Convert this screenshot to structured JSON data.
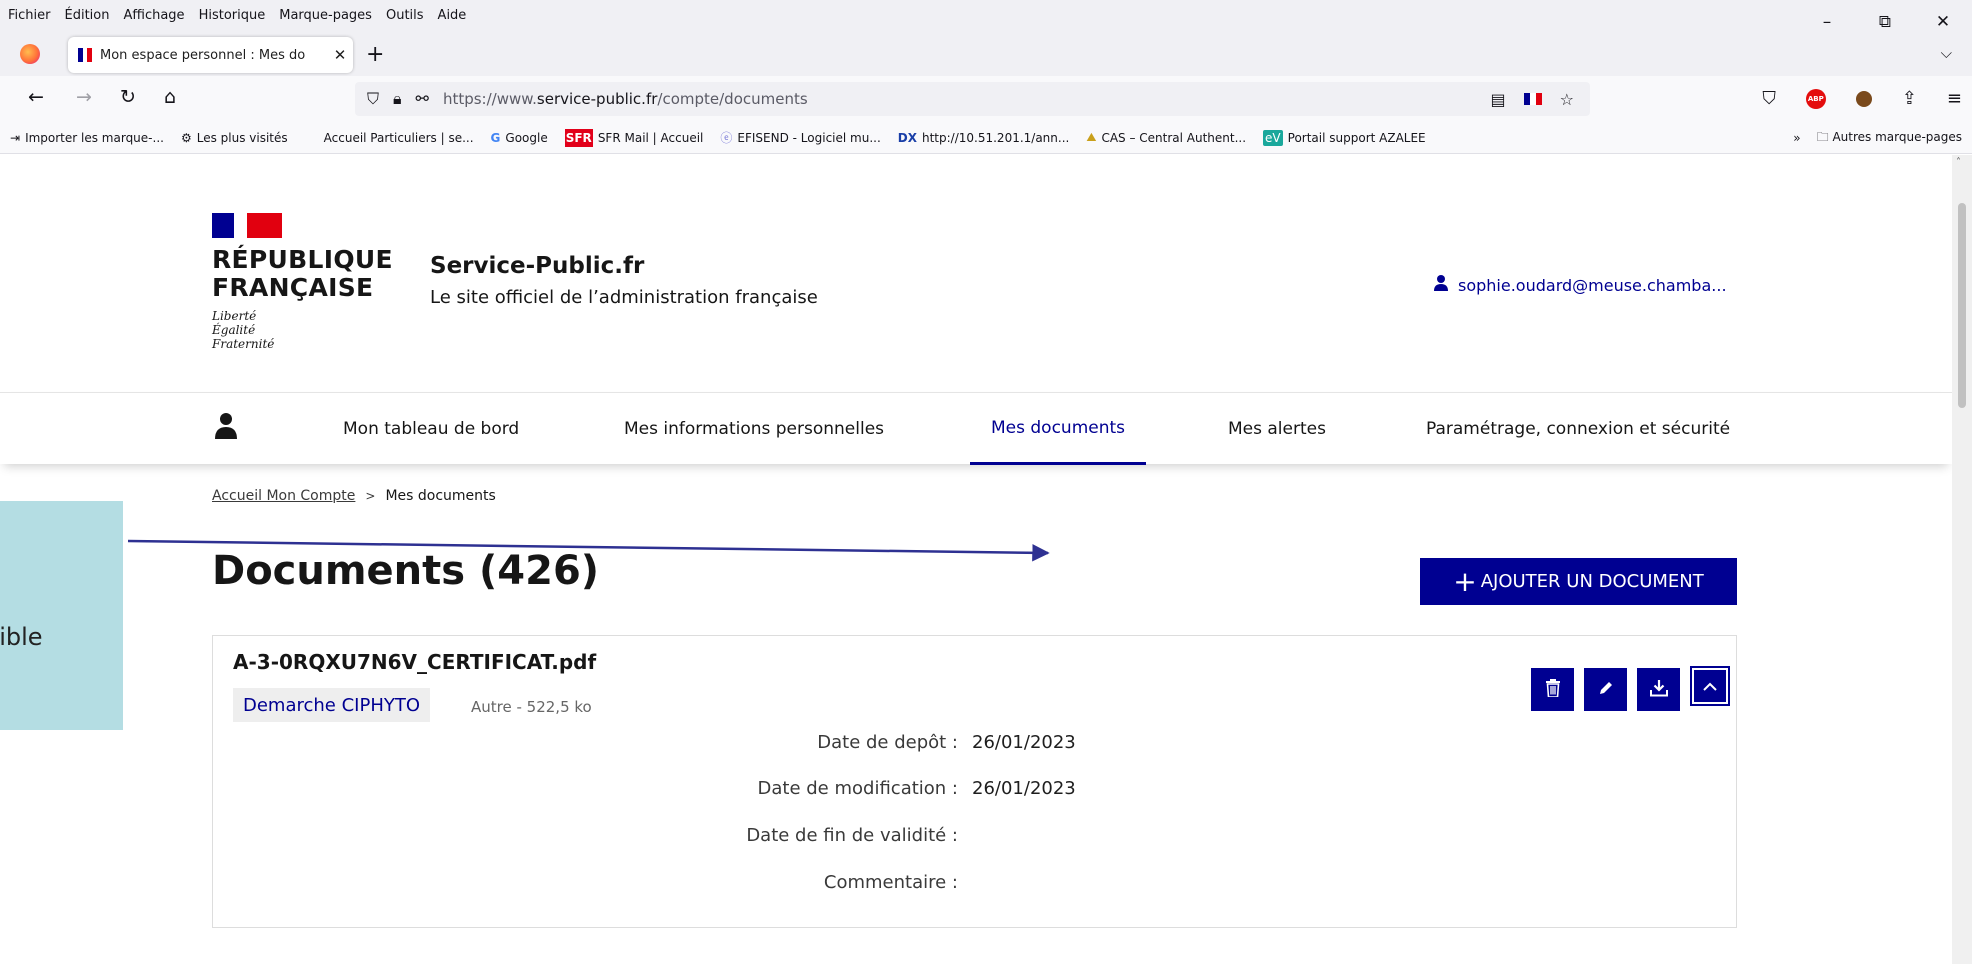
{
  "browser": {
    "menu": [
      "Fichier",
      "Édition",
      "Affichage",
      "Historique",
      "Marque-pages",
      "Outils",
      "Aide"
    ],
    "window_controls": {
      "minimize": "–",
      "restore": "⧉",
      "close": "✕"
    },
    "tab": {
      "title": "Mon espace personnel : Mes do",
      "close": "✕"
    },
    "new_tab": "+",
    "tab_list": "⌵",
    "nav": {
      "back": "←",
      "forward": "→",
      "reload": "↻",
      "home": "⌂"
    },
    "url": {
      "prefix": "https://www.",
      "domain": "service-public.fr",
      "path": "/compte/documents"
    },
    "bookmarks": [
      {
        "label": "Importer les marque-...",
        "icon": "import-icon"
      },
      {
        "label": "Les plus visités",
        "icon": "gear-icon"
      },
      {
        "label": "Accueil Particuliers | se...",
        "icon": "marianne-flag-icon"
      },
      {
        "label": "Google",
        "icon": "google-icon"
      },
      {
        "label": "SFR Mail | Accueil",
        "icon": "sfr-icon"
      },
      {
        "label": "EFISEND - Logiciel mu...",
        "icon": "efisend-icon"
      },
      {
        "label": "http://10.51.201.1/ann...",
        "icon": "dx-icon"
      },
      {
        "label": "CAS – Central Authent...",
        "icon": "cas-icon"
      },
      {
        "label": "Portail support AZALEE",
        "icon": "ev-icon"
      }
    ],
    "more_bookmarks": "»",
    "other_bookmarks": "Autres marque-pages"
  },
  "header": {
    "republique_line1": "RÉPUBLIQUE",
    "republique_line2": "FRANÇAISE",
    "devise": [
      "Liberté",
      "Égalité",
      "Fraternité"
    ],
    "site_title": "Service-Public.fr",
    "site_subtitle": "Le site officiel de l’administration française",
    "user_email": "sophie.oudard@meuse.chamba..."
  },
  "main_nav": {
    "items": [
      {
        "label": "Mon tableau de bord"
      },
      {
        "label": "Mes informations personnelles"
      },
      {
        "label": "Mes documents",
        "active": true
      },
      {
        "label": "Mes alertes"
      },
      {
        "label": "Paramétrage, connexion et sécurité"
      }
    ]
  },
  "breadcrumb": {
    "home": "Accueil Mon Compte",
    "separator": ">",
    "current": "Mes documents"
  },
  "page": {
    "title": "Documents (426)",
    "add_button": "AJOUTER UN DOCUMENT",
    "add_plus": "+"
  },
  "document": {
    "filename": "A-3-0RQXU7N6V_CERTIFICAT.pdf",
    "tag": "Demarche CIPHYTO",
    "meta": "Autre - 522,5 ko",
    "fields": [
      {
        "label": "Date de depôt :",
        "value": "26/01/2023"
      },
      {
        "label": "Date de modification :",
        "value": "26/01/2023"
      },
      {
        "label": "Date de fin de validité :",
        "value": ""
      },
      {
        "label": "Commentaire :",
        "value": ""
      }
    ]
  },
  "annotation": {
    "text": "nible"
  },
  "colors": {
    "primary": "#000091",
    "flag_red": "#e1000f",
    "callout_bg": "#b4dde3"
  }
}
